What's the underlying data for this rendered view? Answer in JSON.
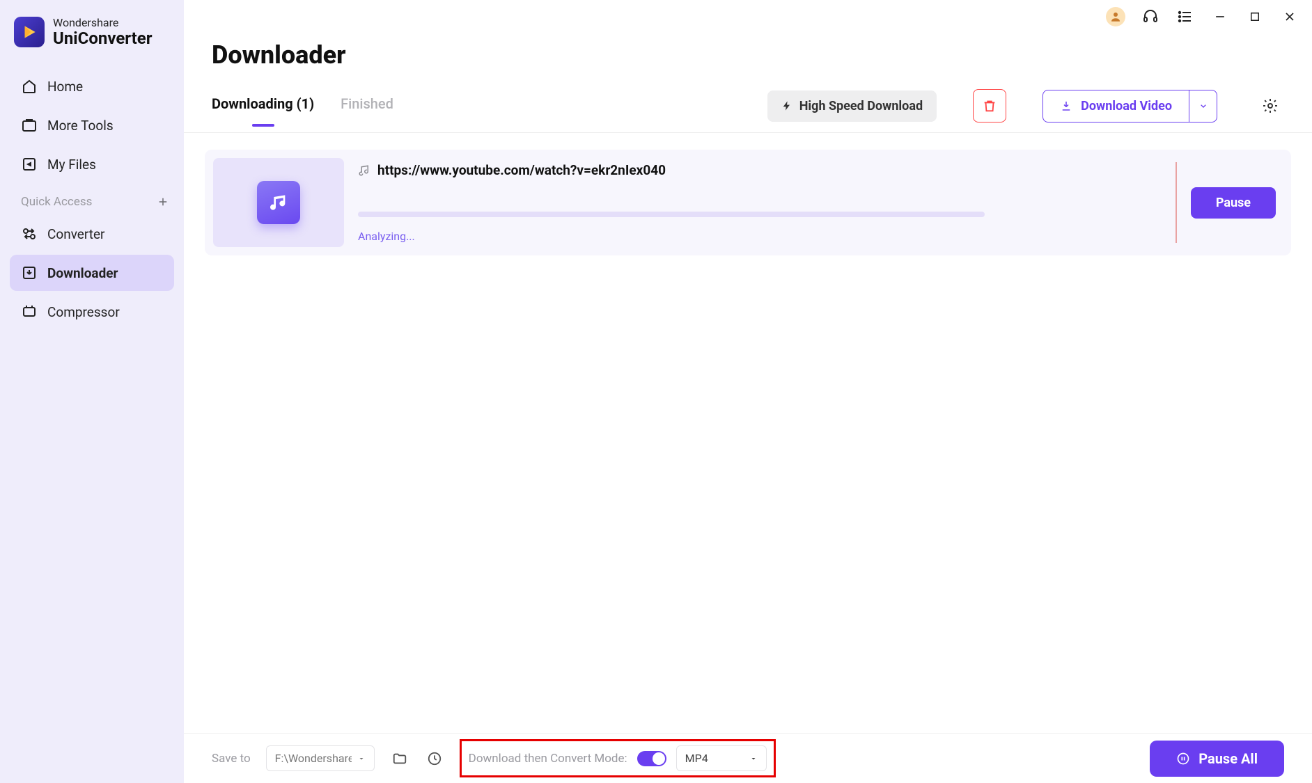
{
  "app": {
    "brand_line1": "Wondershare",
    "brand_line2": "UniConverter"
  },
  "sidebar": {
    "items": [
      {
        "label": "Home"
      },
      {
        "label": "More Tools"
      },
      {
        "label": "My Files"
      }
    ],
    "quick_access_label": "Quick Access",
    "quick_items": [
      {
        "label": "Converter"
      },
      {
        "label": "Downloader"
      },
      {
        "label": "Compressor"
      }
    ]
  },
  "header": {
    "title": "Downloader",
    "tab_downloading": "Downloading (1)",
    "tab_finished": "Finished",
    "high_speed": "High Speed Download",
    "download_video": "Download Video"
  },
  "item": {
    "url": "https://www.youtube.com/watch?v=ekr2nIex040",
    "status": "Analyzing...",
    "pause_label": "Pause"
  },
  "footer": {
    "save_to_label": "Save to",
    "save_to_path": "F:\\Wondershare U",
    "convert_mode_label": "Download then Convert Mode:",
    "format": "MP4",
    "pause_all_label": "Pause All"
  }
}
